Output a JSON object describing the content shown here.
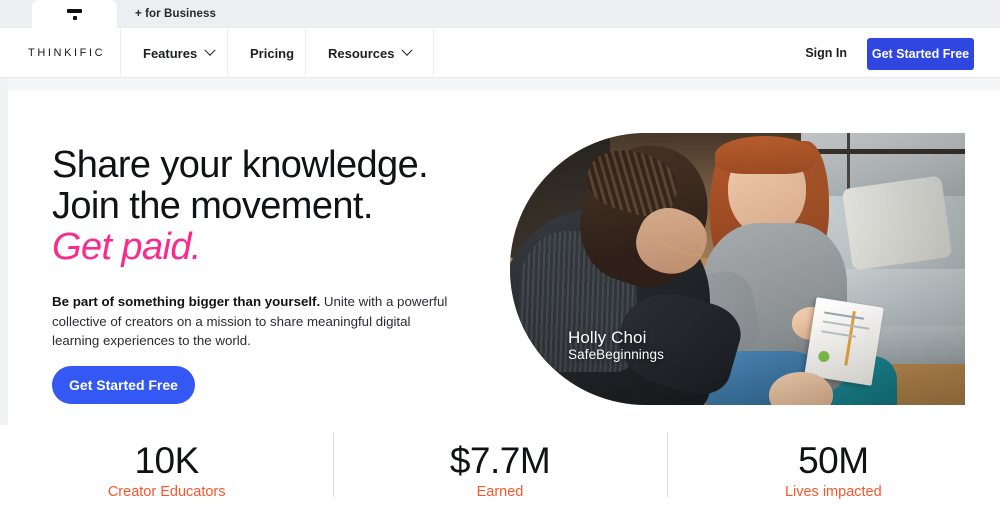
{
  "browser": {
    "tabs": [
      {
        "label": "",
        "icon": "thinkific-favicon-icon",
        "active": true
      },
      {
        "label": "+ for Business",
        "active": false
      }
    ]
  },
  "navbar": {
    "logo": "THINKIFIC",
    "items": [
      {
        "label": "Features",
        "icon": "chevron-down-icon",
        "has_chevron": true
      },
      {
        "label": "Pricing",
        "has_chevron": false
      },
      {
        "label": "Resources",
        "icon": "chevron-down-icon",
        "has_chevron": true
      }
    ],
    "sign_in": "Sign In",
    "cta": "Get Started Free",
    "cta_color": "#2f46e0"
  },
  "hero": {
    "headline_line1": "Share your knowledge.",
    "headline_line2": "Join the movement.",
    "headline_accent": "Get paid.",
    "accent_color": "#fb2b8d",
    "subcopy_bold": "Be part of something bigger than yourself.",
    "subcopy_rest": " Unite with a powerful collective of creators on a mission to share meaningful digital learning experiences to the world.",
    "cta": "Get Started Free",
    "cta_color": "#3358f4",
    "photo": {
      "caption_name": "Holly Choi",
      "caption_org": "SafeBeginnings",
      "alt": "Two women seated on the floor of a living room reviewing a printed handout, baby in foreground"
    }
  },
  "stats": {
    "items": [
      {
        "value": "10K",
        "label": "Creator Educators"
      },
      {
        "value": "$7.7M",
        "label": "Earned"
      },
      {
        "value": "50M",
        "label": "Lives impacted"
      }
    ],
    "label_color": "#f9562a"
  }
}
